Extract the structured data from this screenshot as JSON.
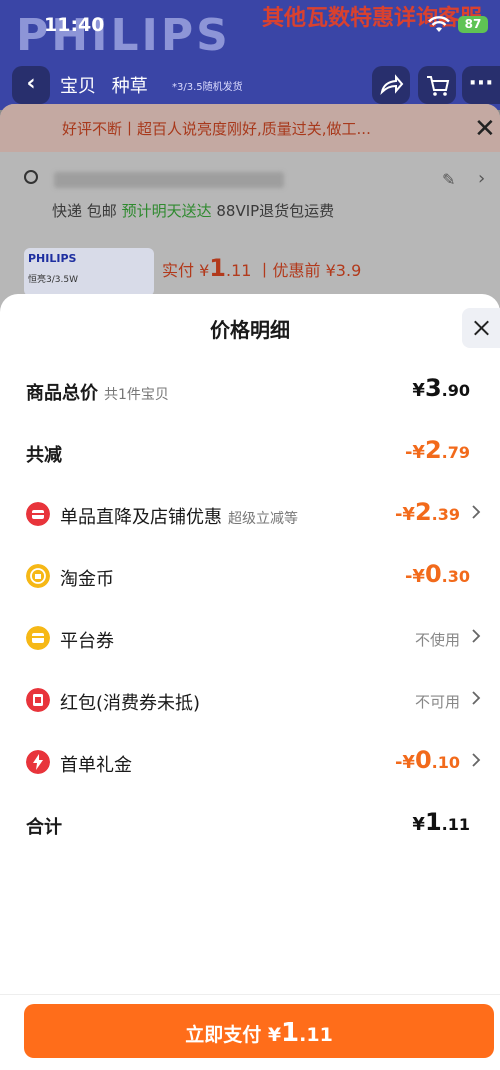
{
  "status_bar": {
    "time": "11:40",
    "battery": "87"
  },
  "background": {
    "brand": "PHILIPS",
    "promo": "其他瓦数特惠详询客服",
    "nav": {
      "tab_product": "宝贝",
      "tab_grass": "种草",
      "note": "*3/3.5随机发货"
    },
    "review_banner": "好评不断丨超百人说亮度刚好,质量过关,做工...",
    "shipping": {
      "express": "快递 包邮",
      "eta": "预计明天送达",
      "vip": "88VIP退货包运费"
    },
    "product_label": "PHILIPS",
    "product_spec": "恒亮3/3.5W",
    "price": {
      "actual_label": "实付 ¥",
      "actual_int": "1",
      "actual_dec": ".11",
      "before_label": "丨优惠前 ¥3.9"
    }
  },
  "sheet": {
    "title": "价格明细",
    "rows": {
      "total": {
        "label": "商品总价",
        "sub": "共1件宝贝",
        "currency": "¥",
        "int": "3",
        "dec": ".90"
      },
      "reduce": {
        "label": "共减",
        "currency": "-¥",
        "int": "2",
        "dec": ".79"
      },
      "store": {
        "label": "单品直降及店铺优惠",
        "sub": "超级立减等",
        "currency": "-¥",
        "int": "2",
        "dec": ".39"
      },
      "coins": {
        "label": "淘金币",
        "currency": "-¥",
        "int": "0",
        "dec": ".30"
      },
      "coupon": {
        "label": "平台券",
        "status": "不使用"
      },
      "redpack": {
        "label": "红包(消费券未抵)",
        "status": "不可用"
      },
      "gift": {
        "label": "首单礼金",
        "currency": "-¥",
        "int": "0",
        "dec": ".10"
      },
      "sum": {
        "label": "合计",
        "currency": "¥",
        "int": "1",
        "dec": ".11"
      }
    },
    "pay_button": {
      "label": "立即支付 ",
      "currency": "¥",
      "int": "1",
      "dec": ".11"
    }
  },
  "colors": {
    "accent": "#ff6d1a",
    "discount": "#f26a1b",
    "red_icon": "#e8343b",
    "gold_icon": "#f6b816"
  },
  "icons": [
    "wifi-icon",
    "share-icon",
    "cart-icon",
    "more-icon",
    "back-icon",
    "close-icon",
    "store-discount-icon",
    "gold-coin-icon",
    "coupon-icon",
    "red-packet-icon",
    "gift-lightning-icon",
    "chevron-right-icon"
  ]
}
